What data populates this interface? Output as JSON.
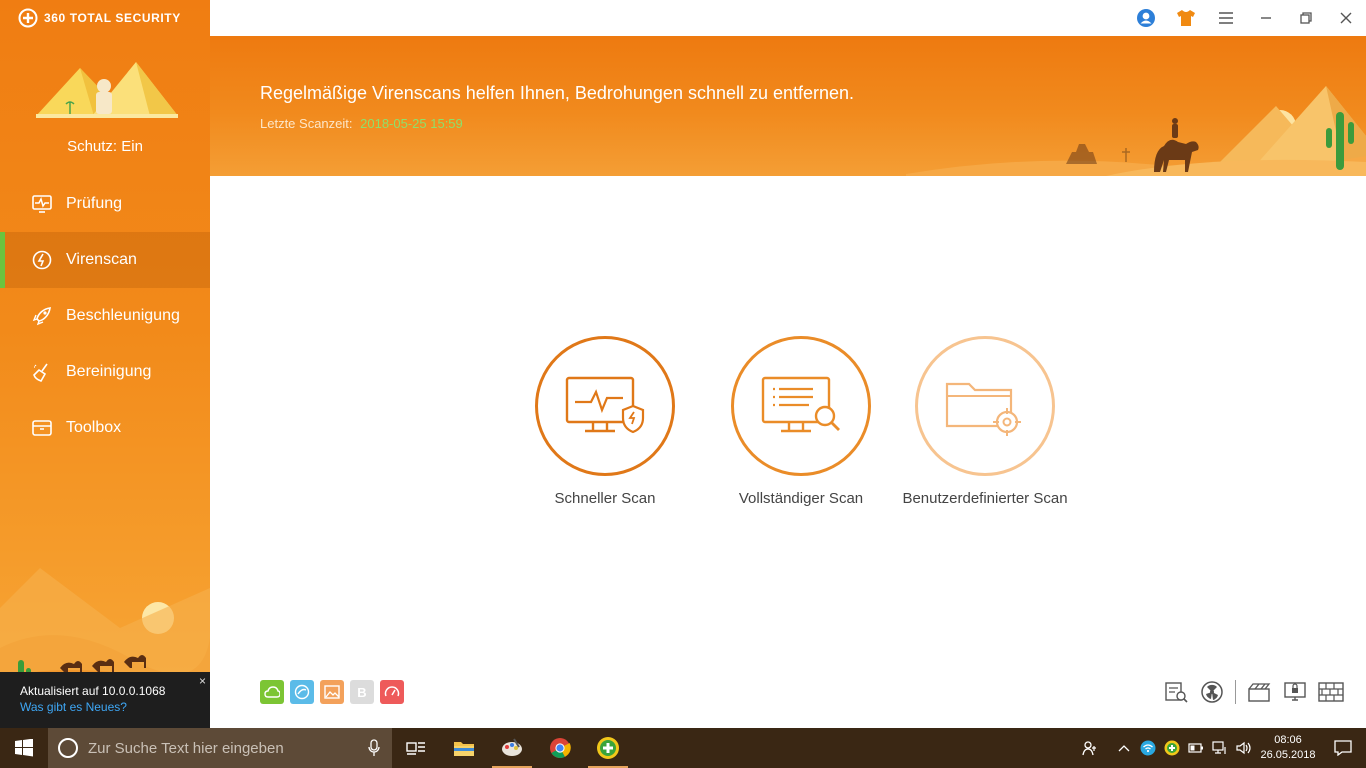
{
  "app": {
    "brand": "360 TOTAL SECURITY"
  },
  "sidebar": {
    "protection_status": "Schutz: Ein",
    "items": [
      {
        "label": "Prüfung",
        "icon": "monitor-pulse-icon"
      },
      {
        "label": "Virenscan",
        "icon": "lightning-circle-icon",
        "active": true
      },
      {
        "label": "Beschleunigung",
        "icon": "rocket-icon"
      },
      {
        "label": "Bereinigung",
        "icon": "broom-icon"
      },
      {
        "label": "Toolbox",
        "icon": "toolbox-icon"
      }
    ],
    "update": {
      "title": "Aktualisiert auf 10.0.0.1068",
      "link": "Was gibt es Neues?",
      "close": "×"
    }
  },
  "banner": {
    "message": "Regelmäßige Virenscans helfen Ihnen, Bedrohungen schnell zu entfernen.",
    "last_scan_label": "Letzte Scanzeit:",
    "last_scan_value": "2018-05-25 15:59"
  },
  "scans": [
    {
      "label": "Schneller Scan",
      "icon": "monitor-shield-icon"
    },
    {
      "label": "Vollständiger Scan",
      "icon": "monitor-search-icon"
    },
    {
      "label": "Benutzerdefinierter Scan",
      "icon": "folder-target-icon"
    }
  ],
  "mini_icons": [
    {
      "name": "cloud-icon",
      "color": "#7cc534"
    },
    {
      "name": "browser-protect-icon",
      "color": "#5bbbe8"
    },
    {
      "name": "image-icon",
      "color": "#f3a15b"
    },
    {
      "name": "letter-b-icon",
      "color": "#dcdcdc",
      "text": "B"
    },
    {
      "name": "speed-gauge-icon",
      "color": "#ee5a5a"
    }
  ],
  "taskbar": {
    "search_placeholder": "Zur Suche Text hier eingeben",
    "time": "08:06",
    "date": "26.05.2018"
  },
  "colors": {
    "accent": "#f07d12",
    "active_marker": "#6bc43e",
    "scan_time": "#8ee06a"
  }
}
